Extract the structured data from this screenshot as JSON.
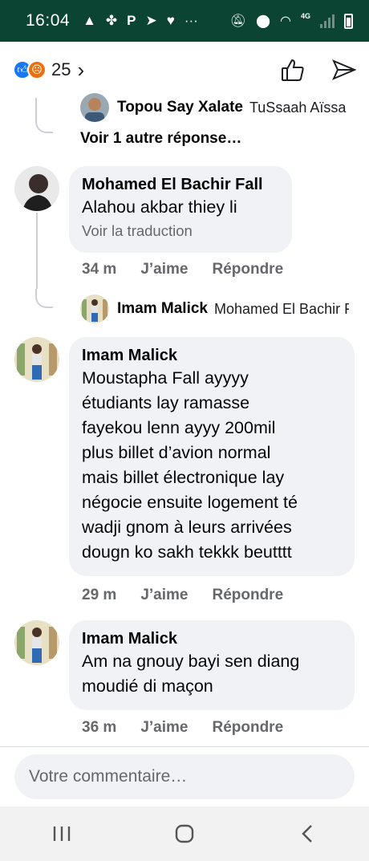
{
  "status_bar": {
    "time": "16:04",
    "left_icons": [
      "warning-icon",
      "fan-icon",
      "p-icon",
      "telegram-icon",
      "heart-icon",
      "more-icon"
    ],
    "right_icons": [
      "mute-icon",
      "location-icon",
      "wifi-icon",
      "4g-signal-icon",
      "battery-icon"
    ],
    "network_label": "4G"
  },
  "reactions": {
    "count": "25",
    "types": [
      "like-icon",
      "angry-icon"
    ],
    "chevron": "›"
  },
  "thread": {
    "reply_preview_1": {
      "name": "Topou Say Xalate",
      "snippet": "TuSsaah Aïssa"
    },
    "more_replies": "Voir 1 autre réponse…",
    "reply_preview_2": {
      "name": "Imam Malick",
      "snippet": "Mohamed El Bachir Fall"
    }
  },
  "comments": [
    {
      "author": "Mohamed El Bachir Fall",
      "text": "Alahou akbar thiey li",
      "translate": "Voir la traduction",
      "time": "34 m",
      "like": "J’aime",
      "reply": "Répondre"
    },
    {
      "author": "Imam Malick",
      "lines": [
        "Moustapha Fall ayyyy",
        "étudiants lay ramasse",
        "fayekou lenn ayyy 200mil",
        "plus billet d’avion normal",
        "mais billet électronique lay",
        "négocie ensuite logement té",
        "wadji gnom à leurs arrivées",
        "dougn ko sakh tekkk beutttt"
      ],
      "time": "29 m",
      "like": "J’aime",
      "reply": "Répondre"
    },
    {
      "author": "Imam Malick",
      "lines": [
        "Am na gnouy bayi sen diang",
        "moudié di maçon"
      ],
      "time": "36 m",
      "like": "J’aime",
      "reply": "Répondre"
    }
  ],
  "composer": {
    "placeholder": "Votre commentaire…"
  },
  "nav": [
    "recent-apps-icon",
    "home-icon",
    "back-icon"
  ],
  "colors": {
    "status_bar": "#0b4432",
    "bubble": "#f0f2f5",
    "meta_text": "#65676b",
    "like_blue": "#1877f2",
    "angry_orange": "#e9710f"
  }
}
